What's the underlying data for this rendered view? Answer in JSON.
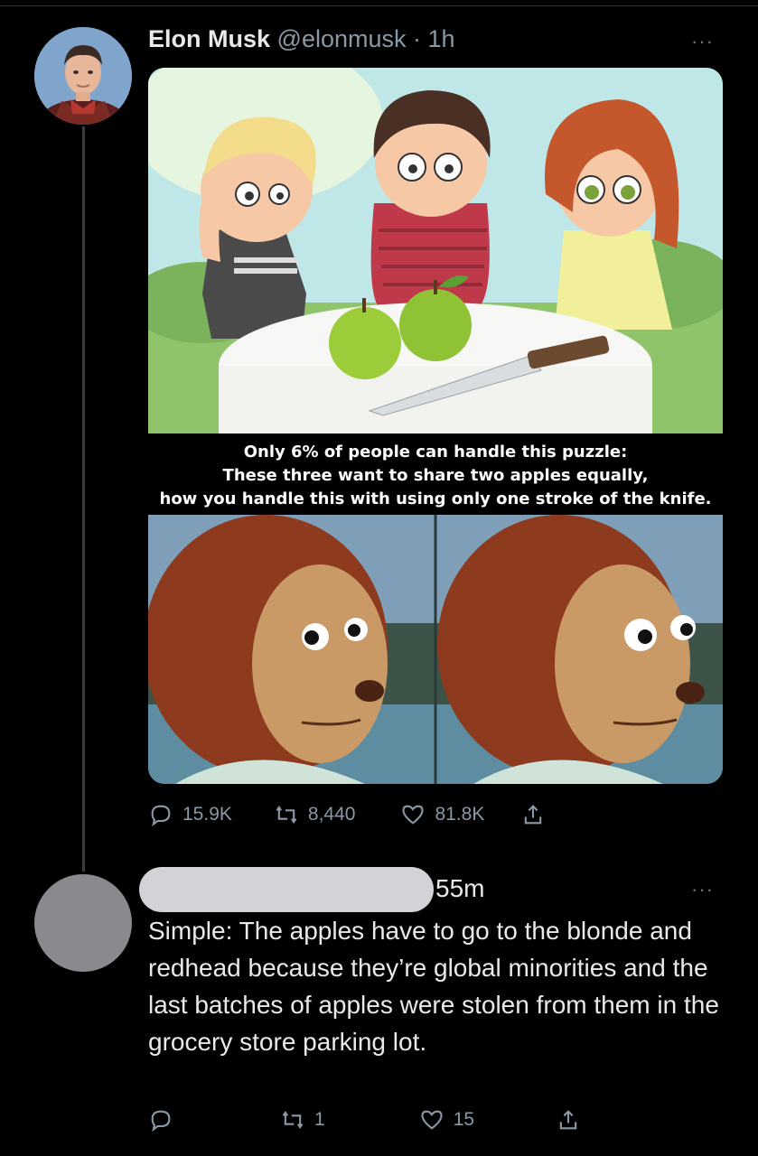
{
  "tweet": {
    "author_name": "Elon Musk",
    "author_handle": "@elonmusk",
    "separator": "·",
    "time": "1h",
    "more": "···",
    "image_caption": {
      "line1": "Only 6% of people can handle this puzzle:",
      "line2": "These three want to share two apples equally,",
      "line3": "how you handle this with using only one stroke of the knife."
    },
    "stats": {
      "replies": "15.9K",
      "retweets": "8,440",
      "likes": "81.8K"
    }
  },
  "reply": {
    "time": "55m",
    "more": "···",
    "text": "Simple: The apples have to go to the blonde and redhead because they’re global minorities and the last batches of apples were stolen from them in the grocery store parking lot.",
    "stats": {
      "replies": "",
      "retweets": "1",
      "likes": "15"
    }
  },
  "icons": {
    "reply": "speech-bubble-icon",
    "retweet": "retweet-icon",
    "like": "heart-icon",
    "share": "share-icon"
  },
  "colors": {
    "background": "#000000",
    "text": "#e7e9ea",
    "secondary": "#8b98a5"
  }
}
